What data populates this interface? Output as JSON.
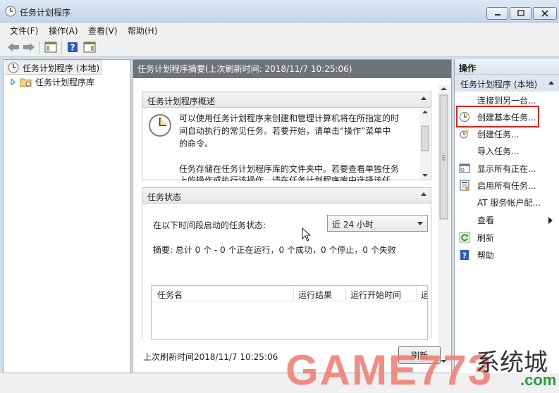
{
  "window": {
    "title": "任务计划程序"
  },
  "menu": {
    "file": "文件(F)",
    "action": "操作(A)",
    "view": "查看(V)",
    "help": "帮助(H)"
  },
  "tree": {
    "root": "任务计划程序 (本地)",
    "library": "任务计划程序库"
  },
  "center": {
    "header": "任务计划程序摘要(上次刷新时间: 2018/11/7 10:25:06)",
    "overview": {
      "title": "任务计划程序概述",
      "lines": [
        "可以使用任务计划程序来创建和管理计算机将在所指定的时",
        "间自动执行的常见任务。若要开始，请单击“操作”菜单中",
        "的命令。",
        "",
        "任务存储在任务计划程序库的文件夹中。若要查看单独任务",
        "上的操作或执行该操作，请在任务计划程序库中选择该任"
      ]
    },
    "status": {
      "title": "任务状态",
      "label": "在以下时间段启动的任务状态:",
      "period_selected": "近 24 小时",
      "summary": "摘要: 总计 0 个 - 0 个正在运行，0 个成功，0 个停止，0 个失败",
      "columns": [
        "任务名",
        "运行结果",
        "运行开始时间",
        "运"
      ]
    },
    "last_refresh": "上次刷新时间2018/11/7 10:25:06",
    "refresh_button": "刷新"
  },
  "actions": {
    "header": "操作",
    "subheader": "任务计划程序 (本地)",
    "items": [
      {
        "label": "连接到另一台...",
        "icon": "none"
      },
      {
        "label": "创建基本任务...",
        "icon": "clock-task-icon"
      },
      {
        "label": "创建任务...",
        "icon": "task-icon"
      },
      {
        "label": "导入任务...",
        "icon": "none"
      },
      {
        "label": "显示所有正在...",
        "icon": "running-tasks-icon"
      },
      {
        "label": "启用所有任务...",
        "icon": "history-icon"
      },
      {
        "label": "AT 服务帐户配...",
        "icon": "none"
      },
      {
        "label": "查看",
        "icon": "none"
      },
      {
        "label": "刷新",
        "icon": "refresh-icon"
      },
      {
        "label": "帮助",
        "icon": "help-icon"
      }
    ]
  },
  "watermark": {
    "brand": "GAME773",
    "site": "系统城",
    "suffix": ".com"
  }
}
